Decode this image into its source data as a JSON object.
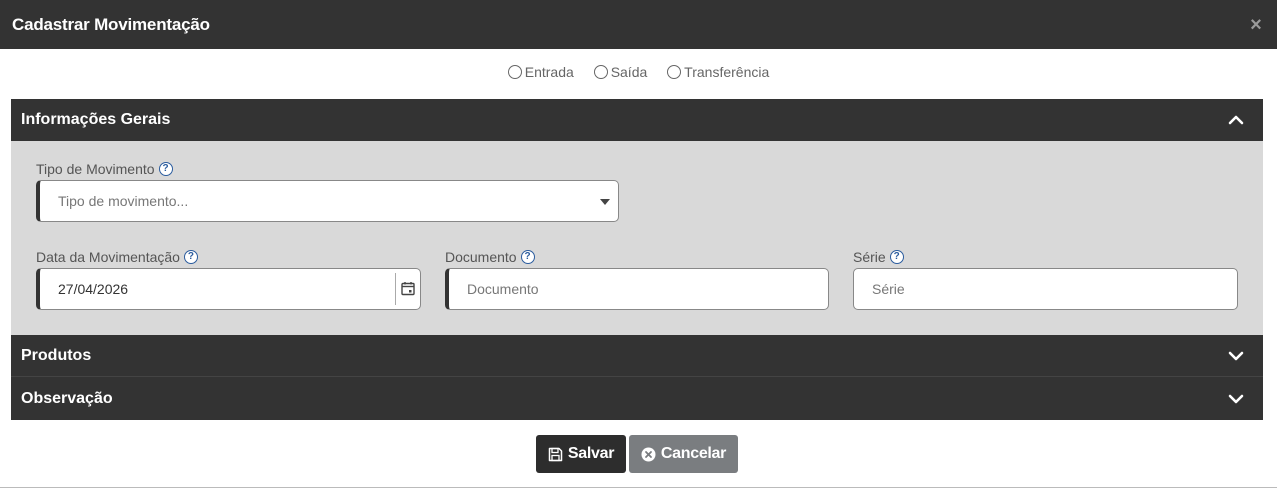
{
  "modal": {
    "title": "Cadastrar Movimentação",
    "close_symbol": "×"
  },
  "movement_types": [
    {
      "label": "Entrada"
    },
    {
      "label": "Saída"
    },
    {
      "label": "Transferência"
    }
  ],
  "sections": {
    "geral": {
      "title": "Informações Gerais",
      "expanded": true,
      "icon": "chevron-up-icon"
    },
    "produtos": {
      "title": "Produtos",
      "expanded": false,
      "icon": "chevron-down-icon"
    },
    "observacao": {
      "title": "Observação",
      "expanded": false,
      "icon": "chevron-down-icon"
    }
  },
  "fields": {
    "tipo": {
      "label": "Tipo de Movimento",
      "placeholder": "Tipo de movimento..."
    },
    "data": {
      "label": "Data da Movimentação",
      "value": "27/04/2026"
    },
    "documento": {
      "label": "Documento",
      "placeholder": "Documento"
    },
    "serie": {
      "label": "Série",
      "placeholder": "Série"
    }
  },
  "buttons": {
    "save": "Salvar",
    "cancel": "Cancelar"
  },
  "colors": {
    "header_bg": "#333333",
    "panel_bg": "#d9d9d9",
    "help_icon": "#2b5c9e",
    "cancel_bg": "#7a7d80"
  }
}
